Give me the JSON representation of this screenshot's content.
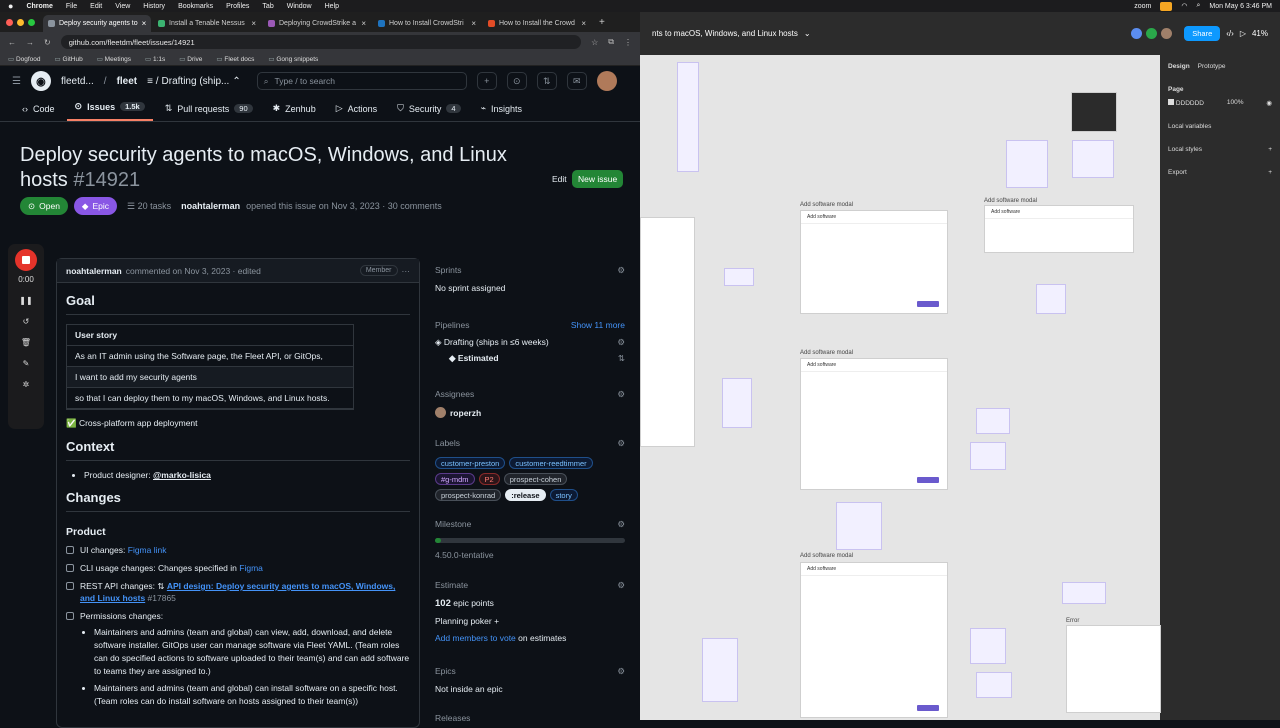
{
  "menubar": {
    "app": "Chrome",
    "items": [
      "File",
      "Edit",
      "View",
      "History",
      "Bookmarks",
      "Profiles",
      "Tab",
      "Window",
      "Help"
    ],
    "zoom": "zoom",
    "datetime": "Mon May 6  3:46 PM"
  },
  "tabs": [
    {
      "title": "Deploy security agents to",
      "color": "#8b949e",
      "active": true
    },
    {
      "title": "Install a Tenable Nessus",
      "color": "#3cb371"
    },
    {
      "title": "Deploying CrowdStrike a",
      "color": "#9b59b6"
    },
    {
      "title": "How to Install CrowdStri",
      "color": "#1e73be"
    },
    {
      "title": "How to Install the Crowd",
      "color": "#e34c26"
    }
  ],
  "address": "github.com/fleetdm/fleet/issues/14921",
  "bookmarks": [
    "Dogfood",
    "GitHub",
    "Meetings",
    "1:1s",
    "Drive",
    "Fleet docs",
    "Gong snippets"
  ],
  "gh": {
    "owner": "fleetd...",
    "repo": "fleet",
    "project": "Drafting (ship...",
    "search": "Type / to search",
    "nav": [
      {
        "label": "Code"
      },
      {
        "label": "Issues",
        "count": "1.5k"
      },
      {
        "label": "Pull requests",
        "count": "90"
      },
      {
        "label": "Zenhub"
      },
      {
        "label": "Actions"
      },
      {
        "label": "Security",
        "count": "4"
      },
      {
        "label": "Insights"
      }
    ],
    "title": "Deploy security agents to macOS, Windows, and Linux hosts",
    "number": "#14921",
    "edit": "Edit",
    "new_issue": "New issue",
    "state": "Open",
    "type": "Epic",
    "tasks": "20 tasks",
    "author": "noahtalerman",
    "opened": "opened this issue on Nov 3, 2023 · 30 comments"
  },
  "recorder": {
    "time": "0:00"
  },
  "comment": {
    "author": "noahtalerman",
    "meta": "commented on Nov 3, 2023 · edited",
    "role": "Member",
    "goal": "Goal",
    "story": [
      "User story",
      "As an IT admin using the Software page, the Fleet API, or GitOps,",
      "I want to add my security agents",
      "so that I can deploy them to my macOS, Windows, and Linux hosts."
    ],
    "crossplatform": "✅ Cross-platform app deployment",
    "context": "Context",
    "designer_label": "Product designer:",
    "designer": "@marko-lisica",
    "changes": "Changes",
    "product": "Product",
    "ui": "UI changes:",
    "ui_link": "Figma link",
    "cli": "CLI usage changes: Changes specified in",
    "cli_link": "Figma",
    "rest": "REST API changes:",
    "rest_link": "API design: Deploy security agents to macOS, Windows, and Linux hosts",
    "rest_num": "#17865",
    "perm": "Permissions changes:",
    "perm1": "Maintainers and admins (team and global) can view, add, download, and delete software installer. GitOps user can manage software via Fleet YAML. (Team roles can do specified actions to software uploaded to their team(s) and can add software to teams they are assigned to.)",
    "perm2": "Maintainers and admins (team and global) can install software on a specific host. (Team roles can do install software on hosts assigned to their team(s))"
  },
  "sidebar": {
    "sprints": "Sprints",
    "sprint_val": "No sprint assigned",
    "pipelines": "Pipelines",
    "show_more": "Show 11 more",
    "pipeline_val": "Drafting (ships in ≤6 weeks)",
    "estimated": "Estimated",
    "assignees": "Assignees",
    "assignee": "roperzh",
    "labels_t": "Labels",
    "labels": [
      {
        "name": "customer-preston",
        "color": "#2f81f7"
      },
      {
        "name": "customer-reedtimmer",
        "color": "#2f81f7"
      },
      {
        "name": "#g-mdm",
        "color": "#a371f7"
      },
      {
        "name": "P2",
        "color": "#da3633"
      },
      {
        "name": "prospect-cohen",
        "color": "#8b949e"
      },
      {
        "name": "prospect-konrad",
        "color": "#8b949e"
      },
      {
        "name": ":release",
        "color": "#e6edf3"
      },
      {
        "name": "story",
        "color": "#2f81f7"
      }
    ],
    "milestone_t": "Milestone",
    "milestone": "4.50.0-tentative",
    "milestone_progress": 0.03,
    "estimate_t": "Estimate",
    "estimate": "102",
    "estimate_unit": "epic points",
    "poker": "Planning poker",
    "poker_add": "Add members to vote",
    "poker_tail": "on estimates",
    "epics_t": "Epics",
    "epics": "Not inside an epic",
    "releases": "Releases"
  },
  "figma": {
    "file": "nts to macOS, Windows, and Linux hosts",
    "share": "Share",
    "zoom": "41%",
    "panel": {
      "design": "Design",
      "prototype": "Prototype",
      "page": "Page",
      "color": "DDDDDD",
      "opacity": "100%",
      "local_vars": "Local variables",
      "local_styles": "Local styles",
      "export": "Export"
    },
    "labels": [
      "Add software modal",
      "Add software modal",
      "Add software modal",
      "Add software modal",
      "Error"
    ],
    "modal_title": "Add software"
  }
}
